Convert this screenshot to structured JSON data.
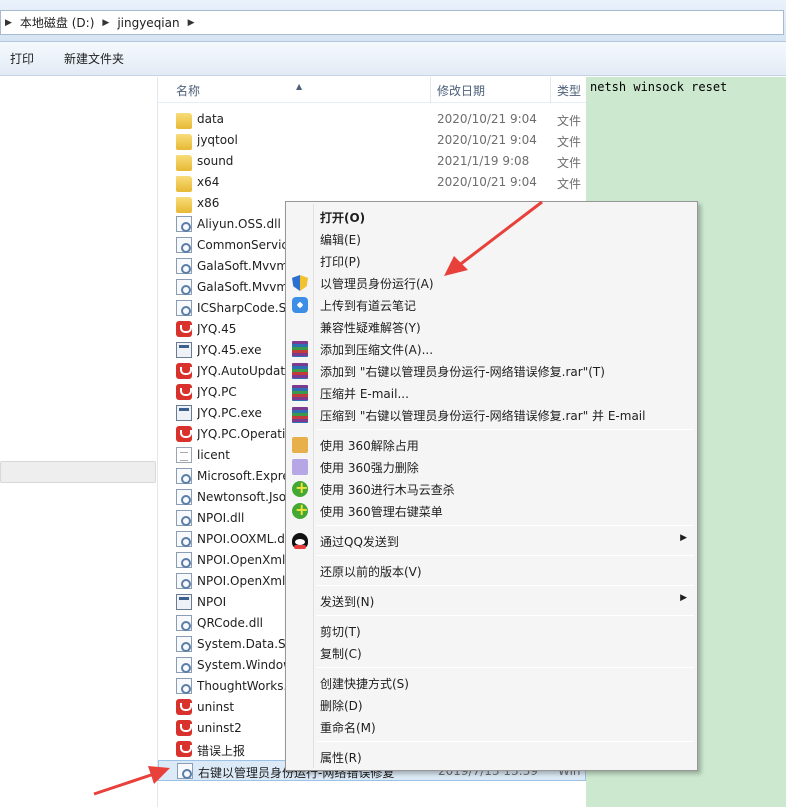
{
  "address": {
    "segments": [
      "本地磁盘 (D:)",
      "jingyeqian"
    ]
  },
  "toolbar": {
    "print": "打印",
    "new_folder": "新建文件夹"
  },
  "columns": {
    "name": "名称",
    "date": "修改日期",
    "type": "类型"
  },
  "files": [
    {
      "name": "data",
      "date": "2020/10/21 9:04",
      "type": "文件",
      "icon": "folder-icon"
    },
    {
      "name": "jyqtool",
      "date": "2020/10/21 9:04",
      "type": "文件",
      "icon": "folder-icon"
    },
    {
      "name": "sound",
      "date": "2021/1/19 9:08",
      "type": "文件",
      "icon": "folder-icon"
    },
    {
      "name": "x64",
      "date": "2020/10/21 9:04",
      "type": "文件",
      "icon": "folder-icon"
    },
    {
      "name": "x86",
      "date": "",
      "type": "",
      "icon": "folder-icon"
    },
    {
      "name": "Aliyun.OSS.dll",
      "date": "",
      "type": "",
      "icon": "dll-icon"
    },
    {
      "name": "CommonServic",
      "date": "",
      "type": "",
      "icon": "dll-icon"
    },
    {
      "name": "GalaSoft.Mvvm",
      "date": "",
      "type": "",
      "icon": "dll-icon"
    },
    {
      "name": "GalaSoft.Mvvm",
      "date": "",
      "type": "",
      "icon": "dll-icon"
    },
    {
      "name": "ICSharpCode.S",
      "date": "",
      "type": "",
      "icon": "dll-icon"
    },
    {
      "name": "JYQ.45",
      "date": "",
      "type": "",
      "icon": "app-config-icon"
    },
    {
      "name": "JYQ.45.exe",
      "date": "",
      "type": "",
      "icon": "exe-icon"
    },
    {
      "name": "JYQ.AutoUpdat",
      "date": "",
      "type": "",
      "icon": "app-config-icon"
    },
    {
      "name": "JYQ.PC",
      "date": "",
      "type": "",
      "icon": "app-config-icon"
    },
    {
      "name": "JYQ.PC.exe",
      "date": "",
      "type": "",
      "icon": "exe-icon"
    },
    {
      "name": "JYQ.PC.Operati",
      "date": "",
      "type": "",
      "icon": "app-config-icon"
    },
    {
      "name": "licent",
      "date": "",
      "type": "",
      "icon": "text-file-icon"
    },
    {
      "name": "Microsoft.Expre",
      "date": "",
      "type": "",
      "icon": "dll-icon"
    },
    {
      "name": "Newtonsoft.Jso",
      "date": "",
      "type": "",
      "icon": "dll-icon"
    },
    {
      "name": "NPOI.dll",
      "date": "",
      "type": "",
      "icon": "dll-icon"
    },
    {
      "name": "NPOI.OOXML.d",
      "date": "",
      "type": "",
      "icon": "dll-icon"
    },
    {
      "name": "NPOI.OpenXml",
      "date": "",
      "type": "",
      "icon": "dll-icon"
    },
    {
      "name": "NPOI.OpenXml",
      "date": "",
      "type": "",
      "icon": "dll-icon"
    },
    {
      "name": "NPOI",
      "date": "",
      "type": "",
      "icon": "exe-icon"
    },
    {
      "name": "QRCode.dll",
      "date": "",
      "type": "",
      "icon": "dll-icon"
    },
    {
      "name": "System.Data.SQ",
      "date": "",
      "type": "",
      "icon": "dll-icon"
    },
    {
      "name": "System.Window",
      "date": "",
      "type": "",
      "icon": "dll-icon"
    },
    {
      "name": "ThoughtWorks.",
      "date": "",
      "type": "",
      "icon": "dll-icon"
    },
    {
      "name": "uninst",
      "date": "",
      "type": "",
      "icon": "app-config-icon"
    },
    {
      "name": "uninst2",
      "date": "",
      "type": "",
      "icon": "app-config-icon"
    },
    {
      "name": "错误上报",
      "date": "",
      "type": "",
      "icon": "app-config-icon"
    },
    {
      "name": "右键以管理员身份运行-网络错误修复",
      "date": "2019/7/13 13:39",
      "type": "Win",
      "icon": "batch-file-icon"
    }
  ],
  "preview": {
    "text": "netsh winsock reset"
  },
  "context_menu": [
    {
      "label": "打开(O)",
      "bold": true,
      "icon": ""
    },
    {
      "label": "编辑(E)",
      "icon": ""
    },
    {
      "label": "打印(P)",
      "icon": ""
    },
    {
      "label": "以管理员身份运行(A)",
      "icon": "uac-shield-icon"
    },
    {
      "label": "上传到有道云笔记",
      "icon": "youdao-note-icon"
    },
    {
      "label": "兼容性疑难解答(Y)",
      "icon": ""
    },
    {
      "label": "添加到压缩文件(A)...",
      "icon": "winrar-icon"
    },
    {
      "label": "添加到 \"右键以管理员身份运行-网络错误修复.rar\"(T)",
      "icon": "winrar-icon"
    },
    {
      "label": "压缩并 E-mail...",
      "icon": "winrar-icon"
    },
    {
      "label": "压缩到 \"右键以管理员身份运行-网络错误修复.rar\" 并 E-mail",
      "icon": "winrar-icon"
    },
    {
      "sep": true
    },
    {
      "label": "使用 360解除占用",
      "icon": "360-unlock-icon"
    },
    {
      "label": "使用 360强力删除",
      "icon": "360-shred-icon"
    },
    {
      "label": "使用 360进行木马云查杀",
      "icon": "360-scan-icon"
    },
    {
      "label": "使用 360管理右键菜单",
      "icon": "360-scan-icon"
    },
    {
      "sep": true
    },
    {
      "label": "通过QQ发送到",
      "icon": "qq-icon",
      "submenu": true
    },
    {
      "sep": true
    },
    {
      "label": "还原以前的版本(V)",
      "icon": ""
    },
    {
      "sep": true
    },
    {
      "label": "发送到(N)",
      "icon": "",
      "submenu": true
    },
    {
      "sep": true
    },
    {
      "label": "剪切(T)",
      "icon": ""
    },
    {
      "label": "复制(C)",
      "icon": ""
    },
    {
      "sep": true
    },
    {
      "label": "创建快捷方式(S)",
      "icon": ""
    },
    {
      "label": "删除(D)",
      "icon": ""
    },
    {
      "label": "重命名(M)",
      "icon": ""
    },
    {
      "sep": true
    },
    {
      "label": "属性(R)",
      "icon": ""
    }
  ],
  "colors": {
    "selection": "#dceaf8",
    "preview_bg": "#cce8cf",
    "annotation_arrow": "#e8403a"
  }
}
